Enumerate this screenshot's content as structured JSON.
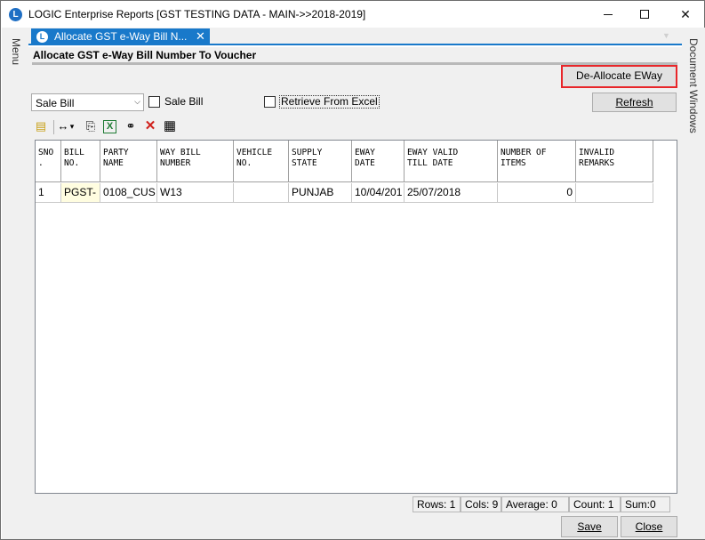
{
  "window": {
    "title": "LOGIC Enterprise Reports  [GST TESTING DATA - MAIN->>2018-2019]",
    "logo_letter": "L",
    "minimize_glyph": "—",
    "maximize_glyph": "☐",
    "close_glyph": "✕"
  },
  "side": {
    "menu_label": "Menu",
    "docs_label": "Document Windows"
  },
  "tab": {
    "label": "Allocate GST e-Way Bill N...",
    "icon_letter": "L",
    "close_glyph": "✕",
    "dropdown_glyph": "▼"
  },
  "form": {
    "title": "Allocate GST e-Way Bill Number To Voucher",
    "dealloc_label": "De-Allocate EWay",
    "refresh_label": "Refresh",
    "type_select_value": "Sale Bill",
    "type_select_arrow": "⌵",
    "sale_bill_checkbox_label": "Sale Bill",
    "retrieve_excel_label": "Retrieve From Excel"
  },
  "toolbar": {
    "icons": [
      "note-icon",
      "column-width-icon",
      "copy-icon",
      "excel-icon",
      "find-icon",
      "delete-icon",
      "grid-icon"
    ],
    "glyphs": {
      "note": "▤",
      "colwidth": "↔",
      "colwidth_arrow": "▾",
      "copy": "⎘",
      "excel": "X",
      "find": "⚭",
      "delete": "✕",
      "grid": "▦"
    },
    "colors": {
      "excel": "#1e7b34",
      "delete": "#d0211c",
      "note": "#c9a21b"
    }
  },
  "grid": {
    "columns": [
      "SNO\n.",
      "BILL\nNO.",
      "PARTY\nNAME",
      "WAY BILL\nNUMBER",
      "VEHICLE\nNO.",
      "SUPPLY\nSTATE",
      "EWAY\nDATE",
      "EWAY VALID\nTILL DATE",
      "NUMBER OF\nITEMS",
      "INVALID\nREMARKS"
    ],
    "rows": [
      [
        "1",
        "PGST-",
        "0108_CUS",
        "W13",
        "",
        "PUNJAB",
        "10/04/201",
        "25/07/2018",
        "0",
        ""
      ]
    ]
  },
  "status": {
    "rows": "Rows: 1",
    "cols": "Cols: 9",
    "average": "Average: 0",
    "count": "Count: 1",
    "sum": "Sum:0"
  },
  "footer": {
    "save_label": "Save",
    "close_label": "Close"
  },
  "colors": {
    "accent": "#1979ca",
    "dealloc_border": "#e8262a",
    "row_highlight": "#fffde0"
  }
}
